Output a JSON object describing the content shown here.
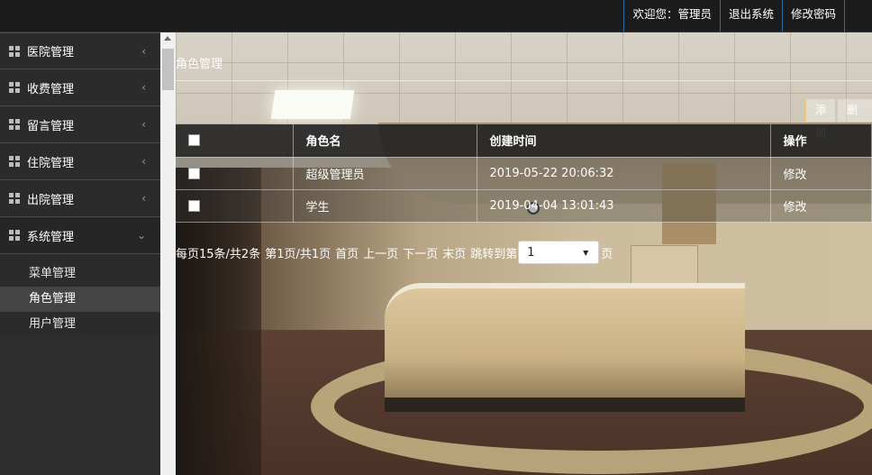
{
  "topbar": {
    "welcome": "欢迎您：管理员",
    "logout": "退出系统",
    "change_password": "修改密码"
  },
  "sidebar": {
    "menus": [
      {
        "label": "医院管理",
        "icon": "grid-icon",
        "chevron": "‹"
      },
      {
        "label": "收费管理",
        "icon": "grid-icon",
        "chevron": "‹"
      },
      {
        "label": "留言管理",
        "icon": "grid-icon",
        "chevron": "‹"
      },
      {
        "label": "住院管理",
        "icon": "grid-icon",
        "chevron": "‹"
      },
      {
        "label": "出院管理",
        "icon": "grid-icon",
        "chevron": "‹"
      },
      {
        "label": "系统管理",
        "icon": "grid-icon",
        "chevron": "⌄"
      }
    ],
    "submenu": [
      {
        "label": "菜单管理"
      },
      {
        "label": "角色管理",
        "active": true
      },
      {
        "label": "用户管理"
      }
    ]
  },
  "main": {
    "breadcrumb": "角色管理",
    "buttons": {
      "add": "添加",
      "delete": "删"
    },
    "table": {
      "headers": [
        "",
        "角色名",
        "创建时间",
        "操作"
      ],
      "rows": [
        {
          "name": "超级管理员",
          "created": "2019-05-22 20:06:32",
          "action": "修改"
        },
        {
          "name": "学生",
          "created": "2019-04-04 13:01:43",
          "action": "修改"
        }
      ]
    },
    "pager": {
      "per_page": "每页15条/共2条",
      "page_info": "第1页/共1页",
      "first": "首页",
      "prev": "上一页",
      "next": "下一页",
      "last": "末页",
      "jump_prefix": "跳转到第",
      "jump_value": "1",
      "jump_suffix": "页"
    }
  },
  "colors": {
    "topbar_bg": "#1b1b1b",
    "sidebar_bg": "#2d2d2d",
    "active_submenu_bg": "#444444",
    "topnav_border": "#2a6fa8",
    "button_border": "#f0c777"
  }
}
